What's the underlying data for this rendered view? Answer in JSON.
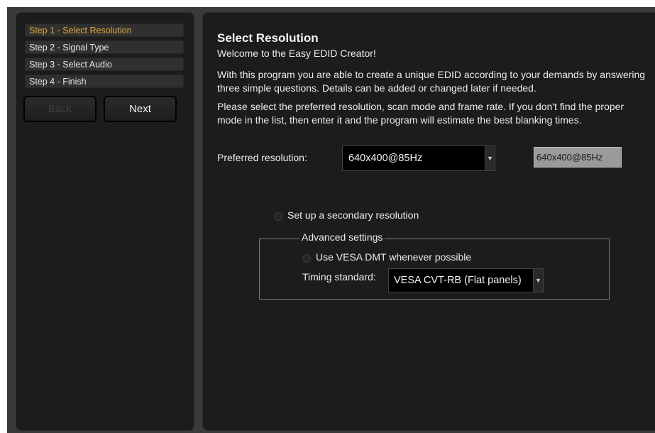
{
  "sidebar": {
    "steps": [
      {
        "label": "Step 1 - Select Resolution",
        "active": true
      },
      {
        "label": "Step 2 - Signal Type",
        "active": false
      },
      {
        "label": "Step 3 - Select Audio",
        "active": false
      },
      {
        "label": "Step 4 - Finish",
        "active": false
      }
    ],
    "back_label": "Back",
    "next_label": "Next"
  },
  "main": {
    "title": "Select Resolution",
    "welcome": "Welcome to the Easy EDID Creator!",
    "intro": "With this program you are able to create a unique EDID according to your demands by answering three simple questions. Details can be added or changed later if needed.",
    "instructions": "Please select the preferred resolution, scan mode and frame rate. If you don't find the proper mode in the list, then enter it and the program will estimate the best blanking times.",
    "preferred_label": "Preferred resolution:",
    "preferred_value": "640x400@85Hz",
    "preferred_text": "640x400@85Hz",
    "secondary_label": "Set up a secondary resolution",
    "advanced": {
      "title": "Advanced settings",
      "vesa_label": "Use VESA DMT whenever possible",
      "timing_label": "Timing standard:",
      "timing_value": "VESA CVT-RB (Flat panels)"
    }
  },
  "colors": {
    "active_step": "#e0a93a",
    "panel_bg": "#1c1c1c",
    "frame_bg": "#3a3a3a"
  }
}
